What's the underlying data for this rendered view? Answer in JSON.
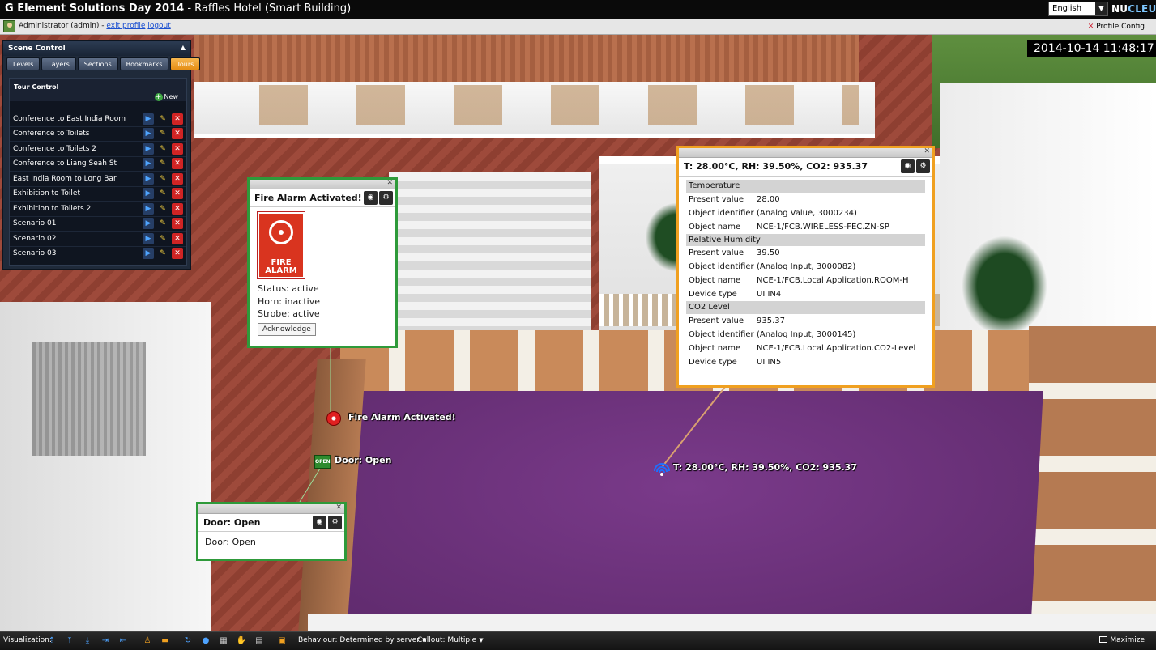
{
  "window": {
    "title_main": "G Element Solutions Day 2014",
    "title_sub": " - Raffles Hotel (Smart Building)",
    "language": "English",
    "brand_main": "NU",
    "brand_accent": "CLEUS"
  },
  "userbar": {
    "user": "Administrator (admin) - ",
    "exit_profile": "exit profile",
    "logout": "logout",
    "profile_config": "Profile Config"
  },
  "clock": "2014-10-14 11:48:17",
  "scene_control": {
    "title": "Scene Control",
    "tabs": [
      {
        "label": "Levels",
        "active": false
      },
      {
        "label": "Layers",
        "active": false
      },
      {
        "label": "Sections",
        "active": false
      },
      {
        "label": "Bookmarks",
        "active": false
      },
      {
        "label": "Tours",
        "active": true
      }
    ],
    "tour_title": "Tour Control",
    "new_label": "New",
    "tours": [
      "Conference to East India Room",
      "Conference to Toilets",
      "Conference to Toilets 2",
      "Conference to Liang Seah St",
      "East India Room to Long Bar",
      "Exhibition to Toilet",
      "Exhibition to Toilets 2",
      "Scenario 01",
      "Scenario 02",
      "Scenario 03"
    ]
  },
  "fire_popup": {
    "title": "Fire Alarm Activated!",
    "sign_line1": "FIRE",
    "sign_line2": "ALARM",
    "status": "Status: active",
    "horn": "Horn: inactive",
    "strobe": "Strobe: active",
    "acknowledge": "Acknowledge"
  },
  "door_popup": {
    "title": "Door: Open",
    "body": "Door: Open"
  },
  "sensor_popup": {
    "title": "T: 28.00°C, RH: 39.50%, CO2: 935.37",
    "sections": [
      {
        "header": "Temperature",
        "rows": [
          {
            "k": "Present value",
            "v": "28.00"
          },
          {
            "k": "Object identifier",
            "v": "(Analog Value, 3000234)"
          },
          {
            "k": "Object name",
            "v": "NCE-1/FCB.WIRELESS-FEC.ZN-SP"
          }
        ]
      },
      {
        "header": "Relative Humidity",
        "rows": [
          {
            "k": "Present value",
            "v": "39.50"
          },
          {
            "k": "Object identifier",
            "v": "(Analog Input, 3000082)"
          },
          {
            "k": "Object name",
            "v": "NCE-1/FCB.Local Application.ROOM-H"
          },
          {
            "k": "Device type",
            "v": "UI IN4"
          }
        ]
      },
      {
        "header": "CO2 Level",
        "rows": [
          {
            "k": "Present value",
            "v": "935.37"
          },
          {
            "k": "Object identifier",
            "v": "(Analog Input, 3000145)"
          },
          {
            "k": "Object name",
            "v": "NCE-1/FCB.Local Application.CO2-Level"
          },
          {
            "k": "Device type",
            "v": "UI IN5"
          }
        ]
      }
    ]
  },
  "markers": {
    "fire": "Fire Alarm Activated!",
    "door_icon": "OPEN",
    "door": "Door: Open",
    "sensor": "T: 28.00°C, RH: 39.50%, CO2: 935.37"
  },
  "toolbar": {
    "visualization": "Visualization:",
    "behaviour": "Behaviour: Determined by server",
    "callout": "Callout: Multiple",
    "maximize": "Maximize"
  },
  "colors": {
    "fire_border": "#2e9a3a",
    "sensor_border": "#f0a020",
    "tab_active": "#e58e15",
    "room_floor": "#6a2f7a"
  }
}
